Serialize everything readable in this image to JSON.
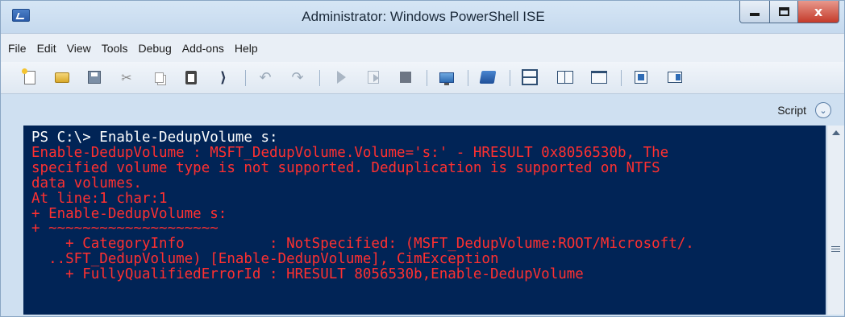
{
  "window": {
    "title": "Administrator: Windows PowerShell ISE",
    "minimize_icon": "minimize-icon",
    "maximize_icon": "maximize-icon",
    "close_icon": "close-icon",
    "close_glyph": "x"
  },
  "menu": {
    "items": [
      "File",
      "Edit",
      "View",
      "Tools",
      "Debug",
      "Add-ons",
      "Help"
    ]
  },
  "toolbar": {
    "icons": [
      "new-script-icon",
      "open-icon",
      "save-icon",
      "cut-icon",
      "copy-icon",
      "paste-icon",
      "clear-console-icon",
      "undo-icon",
      "redo-icon",
      "run-script-icon",
      "run-selection-icon",
      "stop-icon",
      "remote-powershell-icon",
      "powershell-console-icon",
      "show-script-top-icon",
      "show-script-right-icon",
      "show-script-maximized-icon",
      "show-commands-icon",
      "show-addon-icon"
    ]
  },
  "script_pane": {
    "label": "Script",
    "toggle_glyph": "⌄"
  },
  "console": {
    "background": "#012456",
    "error_color": "#ff3030",
    "lines": [
      {
        "kind": "prompt",
        "text": "PS C:\\> Enable-DedupVolume s:"
      },
      {
        "kind": "error",
        "text": "Enable-DedupVolume : MSFT_DedupVolume.Volume='s:' - HRESULT 0x8056530b, The"
      },
      {
        "kind": "error",
        "text": "specified volume type is not supported. Deduplication is supported on NTFS"
      },
      {
        "kind": "error",
        "text": "data volumes."
      },
      {
        "kind": "error",
        "text": "At line:1 char:1"
      },
      {
        "kind": "error",
        "text": "+ Enable-DedupVolume s:"
      },
      {
        "kind": "error",
        "text": "+ ~~~~~~~~~~~~~~~~~~~~"
      },
      {
        "kind": "error",
        "text": "    + CategoryInfo          : NotSpecified: (MSFT_DedupVolume:ROOT/Microsoft/."
      },
      {
        "kind": "error",
        "text": "  ..SFT_DedupVolume) [Enable-DedupVolume], CimException"
      },
      {
        "kind": "error",
        "text": "    + FullyQualifiedErrorId : HRESULT 8056530b,Enable-DedupVolume"
      }
    ]
  }
}
